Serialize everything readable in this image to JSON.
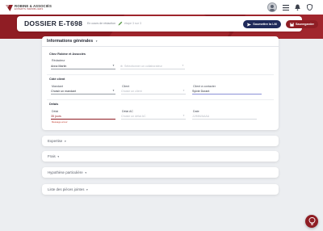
{
  "app": {
    "logo_name": "ROBINE & ASSOCIÉS",
    "logo_sub": "EXPERTS IMMOBILIERS"
  },
  "topbar": {
    "icons": [
      "avatar",
      "menu-icon",
      "bell-icon",
      "shield-icon"
    ]
  },
  "header": {
    "title": "DOSSIER E-T698",
    "status": "En cours de rédaction",
    "step": "étape 3 sur 3",
    "submit_label": "Soumettre la LM",
    "save_label": "Sauvegarder"
  },
  "general": {
    "section_title": "Informations générales",
    "chez": {
      "title": "Chez Robine et Associés",
      "redacteur_label": "Rédacteur",
      "redacteur_value": "Anna Martin",
      "second_placeholder": "Sélectionner un collaborateur"
    },
    "client": {
      "title": "Côté client",
      "mandant_label": "Mandant",
      "mandant_value": "Choisir un mandant",
      "client_label": "Client",
      "client_value": "Choisir un client",
      "contact_label": "Client à contacter",
      "contact_value": "Sylvie Dorant"
    },
    "delais": {
      "title": "Délais",
      "delai_label": "Délai",
      "delai_value": "35 jours",
      "delai_error": "Message erreur",
      "delai_ac_label": "Délai AC",
      "delai_ac_value": "Choisir un délai AC",
      "date_label": "Date",
      "date_value": "JJ/MM/AAAA"
    }
  },
  "sections": [
    {
      "label": "Expertise"
    },
    {
      "label": "Frais"
    },
    {
      "label": "Hypothèse particulière"
    },
    {
      "label": "Liste des pièces jointes"
    }
  ],
  "colors": {
    "brand": "#8f1d24",
    "navy": "#1f2a5a",
    "accent_underline": "#8c91d8"
  }
}
